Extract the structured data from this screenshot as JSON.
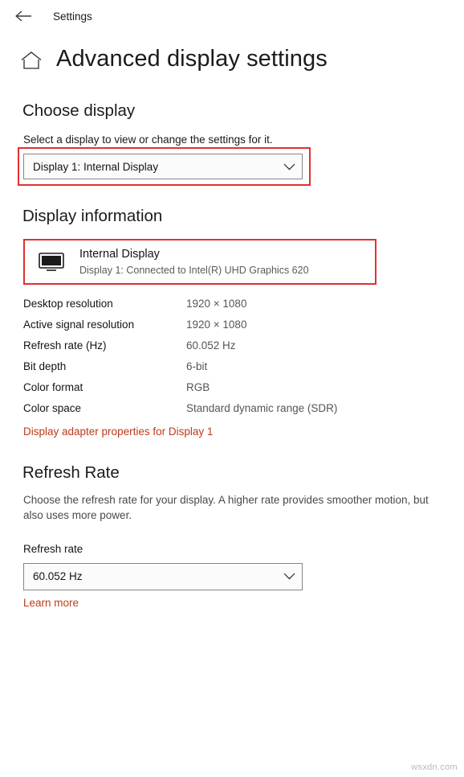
{
  "titlebar": {
    "back_icon": "arrow-left-icon",
    "app_label": "Settings"
  },
  "header": {
    "home_icon": "home-icon",
    "title": "Advanced display settings"
  },
  "choose_display": {
    "heading": "Choose display",
    "description": "Select a display to view or change the settings for it.",
    "selected": "Display 1: Internal Display",
    "chevron": "chevron-down-icon"
  },
  "display_information": {
    "heading": "Display information",
    "monitor_icon": "monitor-icon",
    "monitor_name": "Internal Display",
    "monitor_sub": "Display 1: Connected to Intel(R) UHD Graphics 620",
    "specs": [
      {
        "name": "Desktop resolution",
        "value": "1920 × 1080"
      },
      {
        "name": "Active signal resolution",
        "value": "1920 × 1080"
      },
      {
        "name": "Refresh rate (Hz)",
        "value": "60.052 Hz"
      },
      {
        "name": "Bit depth",
        "value": "6-bit"
      },
      {
        "name": "Color format",
        "value": "RGB"
      },
      {
        "name": "Color space",
        "value": "Standard dynamic range (SDR)"
      }
    ],
    "adapter_link": "Display adapter properties for Display 1"
  },
  "refresh_rate": {
    "heading": "Refresh Rate",
    "description": "Choose the refresh rate for your display. A higher rate provides smoother motion, but also uses more power.",
    "field_label": "Refresh rate",
    "selected": "60.052 Hz",
    "chevron": "chevron-down-icon",
    "learn_more": "Learn more"
  },
  "watermark": "wsxdn.com",
  "colors": {
    "accent_link": "#bb3b1b",
    "highlight_box": "#e03030",
    "text": "#141414",
    "muted": "#555555"
  }
}
